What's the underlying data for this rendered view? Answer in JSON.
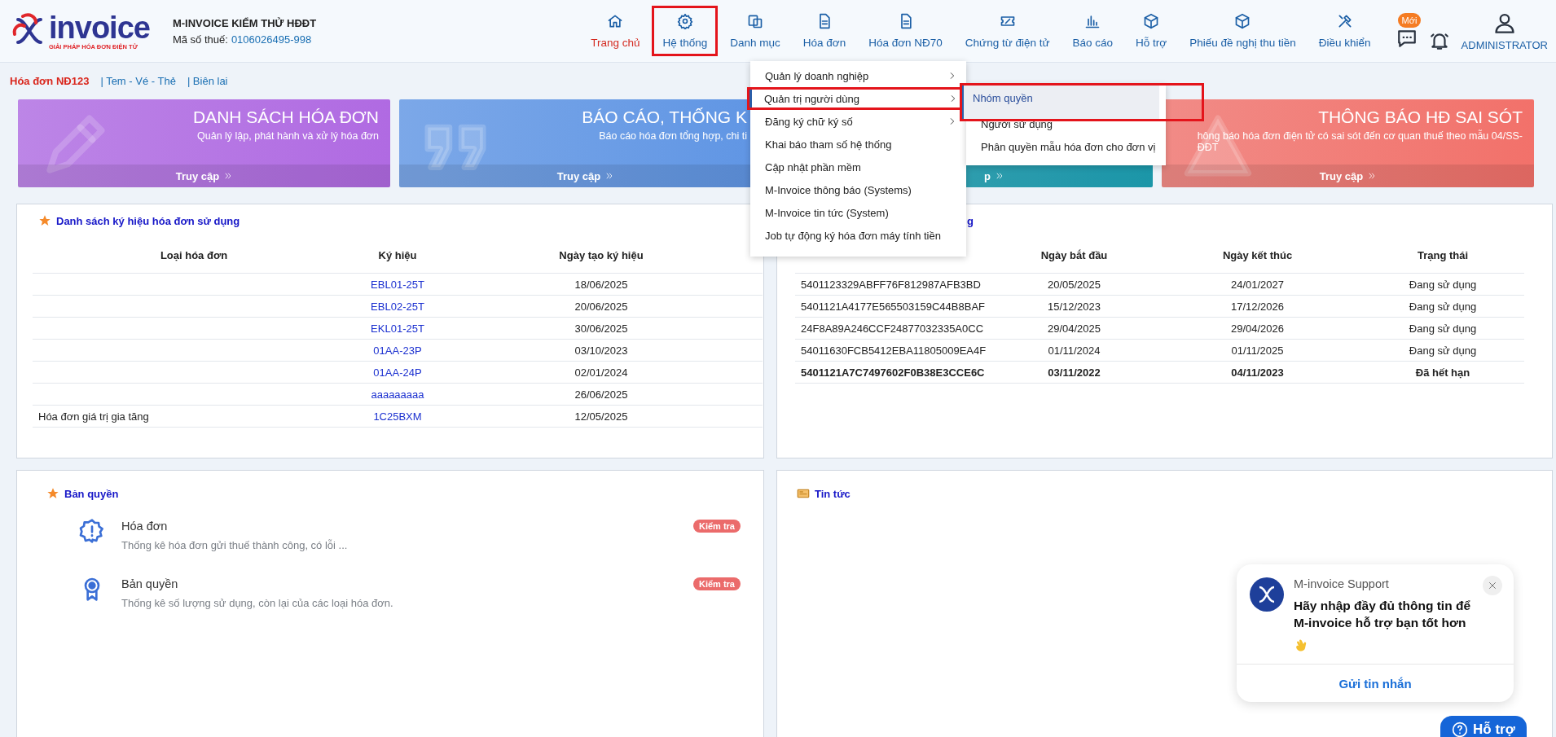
{
  "header": {
    "logo": {
      "wordmark": "invoice",
      "tagline": "GIẢI PHÁP HÓA ĐƠN ĐIỆN TỬ"
    },
    "company": "M-INVOICE KIỂM THỬ HĐĐT",
    "tax_label": "Mã số thuế:",
    "tax_code": "0106026495-998",
    "nav": [
      {
        "label": "Trang chủ",
        "kind": "home",
        "selected": true,
        "highlighted": false
      },
      {
        "label": "Hệ thống",
        "kind": "gear",
        "selected": false,
        "highlighted": true
      },
      {
        "label": "Danh mục",
        "kind": "folders",
        "selected": false,
        "highlighted": false
      },
      {
        "label": "Hóa đơn",
        "kind": "document",
        "selected": false,
        "highlighted": false
      },
      {
        "label": "Hóa đơn NĐ70",
        "kind": "document",
        "selected": false,
        "highlighted": false
      },
      {
        "label": "Chứng từ điện tử",
        "kind": "ticket",
        "selected": false,
        "highlighted": false
      },
      {
        "label": "Báo cáo",
        "kind": "chart",
        "selected": false,
        "highlighted": false
      },
      {
        "label": "Hỗ trợ",
        "kind": "cube",
        "selected": false,
        "highlighted": false
      },
      {
        "label": "Phiếu đề nghị thu tiền",
        "kind": "cube",
        "selected": false,
        "highlighted": false
      },
      {
        "label": "Điều khiển",
        "kind": "tools",
        "selected": false,
        "highlighted": false
      }
    ],
    "messages_badge": "Mới",
    "user": "ADMINISTRATOR"
  },
  "subnav": [
    {
      "label": "Hóa đơn NĐ123",
      "selected": true
    },
    {
      "label": "| Tem - Vé - Thẻ",
      "selected": false
    },
    {
      "label": "| Biên lai",
      "selected": false
    }
  ],
  "banners": [
    {
      "title": "DANH SÁCH HÓA ĐƠN",
      "subtitle": [
        "Quản lý lập, phát hành và xử lý hóa đơn"
      ],
      "link": "Truy cập",
      "kind": "pencil",
      "color": "#b06ae2"
    },
    {
      "title": "BÁO CÁO, THỐNG K",
      "subtitle": [
        "Báo cáo hóa đơn tổng hợp, chi ti"
      ],
      "link": "Truy cập",
      "kind": "quote",
      "color": "#5f95e4"
    },
    {
      "link": "p",
      "color": "#1ea5b9"
    },
    {
      "title": "THÔNG BÁO HĐ SAI SÓT",
      "subtitle": [
        "hông báo hóa đơn điện tử có sai sót đến cơ quan thuế theo mẫu 04/SS-",
        "ĐĐT"
      ],
      "link": "Truy cập",
      "kind": "warning",
      "color": "#f2716a"
    }
  ],
  "symbols_panel": {
    "title": "Danh sách ký hiệu hóa đơn sử dụng",
    "columns": [
      "Loại hóa đơn",
      "Ký hiệu",
      "Ngày tạo ký hiệu"
    ],
    "rows": [
      {
        "symbol": "EBL01-25T",
        "date": "18/06/2025"
      },
      {
        "symbol": "EBL02-25T",
        "date": "20/06/2025"
      },
      {
        "symbol": "EKL01-25T",
        "date": "30/06/2025"
      },
      {
        "symbol": "01AA-23P",
        "date": "03/10/2023"
      },
      {
        "symbol": "01AA-24P",
        "date": "02/01/2024"
      },
      {
        "symbol": "aaaaaaaaa",
        "date": "26/06/2025"
      },
      {
        "type": "Hóa đơn giá trị gia tăng",
        "symbol": "1C25BXM",
        "date": "12/05/2025"
      }
    ]
  },
  "certificates_panel": {
    "title": "g",
    "columns": [
      "Ngày bắt đầu",
      "Ngày kết thúc",
      "Trạng thái"
    ],
    "rows": [
      {
        "column_1": "5401123329ABFF76F812987AFB3BD",
        "start": "20/05/2025",
        "end": "24/01/2027",
        "status": "Đang sử dụng",
        "expired": false
      },
      {
        "column_1": "5401121A4177E565503159C44B8BAF",
        "start": "15/12/2023",
        "end": "17/12/2026",
        "status": "Đang sử dụng",
        "expired": false
      },
      {
        "column_1": "24F8A89A246CCF24877032335A0CC",
        "start": "29/04/2025",
        "end": "29/04/2026",
        "status": "Đang sử dụng",
        "expired": false
      },
      {
        "column_1": "54011630FCB5412EBA11805009EA4F",
        "start": "01/11/2024",
        "end": "01/11/2025",
        "status": "Đang sử dụng",
        "expired": false
      },
      {
        "column_1": "5401121A7C7497602F0B38E3CCE6C",
        "start": "03/11/2022",
        "end": "04/11/2023",
        "status": "Đã hết hạn",
        "expired": true
      }
    ]
  },
  "license_panel": {
    "title": "Bản quyền",
    "items": [
      {
        "title": "Hóa đơn",
        "description": "Thống kê hóa đơn gửi thuế thành công, có lỗi ...",
        "badge": "Kiểm tra",
        "kind": "alert"
      },
      {
        "title": "Bản quyền",
        "description": "Thống kê số lượng sử dụng, còn lại của các loại hóa đơn.",
        "badge": "Kiểm tra",
        "kind": "award"
      }
    ]
  },
  "news_panel": {
    "title": "Tin tức"
  },
  "system_menu": {
    "items": [
      {
        "label": "Quản lý doanh nghiệp",
        "has_submenu": true,
        "selected": false,
        "highlighted": false
      },
      {
        "label": "Quản trị người dùng",
        "has_submenu": true,
        "selected": true,
        "highlighted": true
      },
      {
        "label": "Đăng ký chữ ký số",
        "has_submenu": true,
        "selected": false,
        "highlighted": false
      },
      {
        "label": "Khai báo tham số hệ thống",
        "has_submenu": false,
        "selected": false,
        "highlighted": false
      },
      {
        "label": "Cập nhật phần mềm",
        "has_submenu": false,
        "selected": false,
        "highlighted": false
      },
      {
        "label": "M-Invoice thông báo (Systems)",
        "has_submenu": false,
        "selected": false,
        "highlighted": false
      },
      {
        "label": "M-Invoice tin tức (System)",
        "has_submenu": false,
        "selected": false,
        "highlighted": false
      },
      {
        "label": "Job tự động ký hóa đơn máy tính tiền",
        "has_submenu": false,
        "selected": false,
        "highlighted": false
      }
    ],
    "submenu": [
      {
        "label": "Nhóm quyền",
        "selected": true,
        "highlighted": true
      },
      {
        "label": "Người sử dụng",
        "selected": false,
        "highlighted": false
      },
      {
        "label": "Phân quyền mẫu hóa đơn cho đơn vị",
        "selected": false,
        "highlighted": false
      }
    ]
  },
  "chat": {
    "sender": "M-invoice Support",
    "message": "Hãy nhập đầy đủ thông tin để M-invoice hỗ trợ bạn tốt hơn",
    "action": "Gửi tin nhắn"
  },
  "help_button": "Hỗ trợ"
}
